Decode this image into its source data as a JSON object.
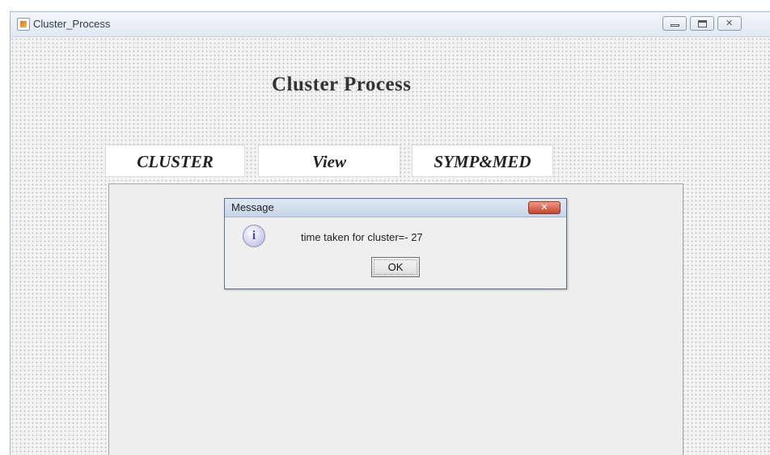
{
  "window": {
    "title": "Cluster_Process"
  },
  "main": {
    "heading": "Cluster Process",
    "tabs": [
      {
        "label": "CLUSTER"
      },
      {
        "label": "View"
      },
      {
        "label": "SYMP&MED"
      }
    ]
  },
  "dialog": {
    "title": "Message",
    "icon": "info-icon",
    "message": "time taken for cluster=- 27",
    "ok_label": "OK"
  },
  "colors": {
    "dialog_close": "#c9452d",
    "panel_bg": "#eeeeee"
  }
}
